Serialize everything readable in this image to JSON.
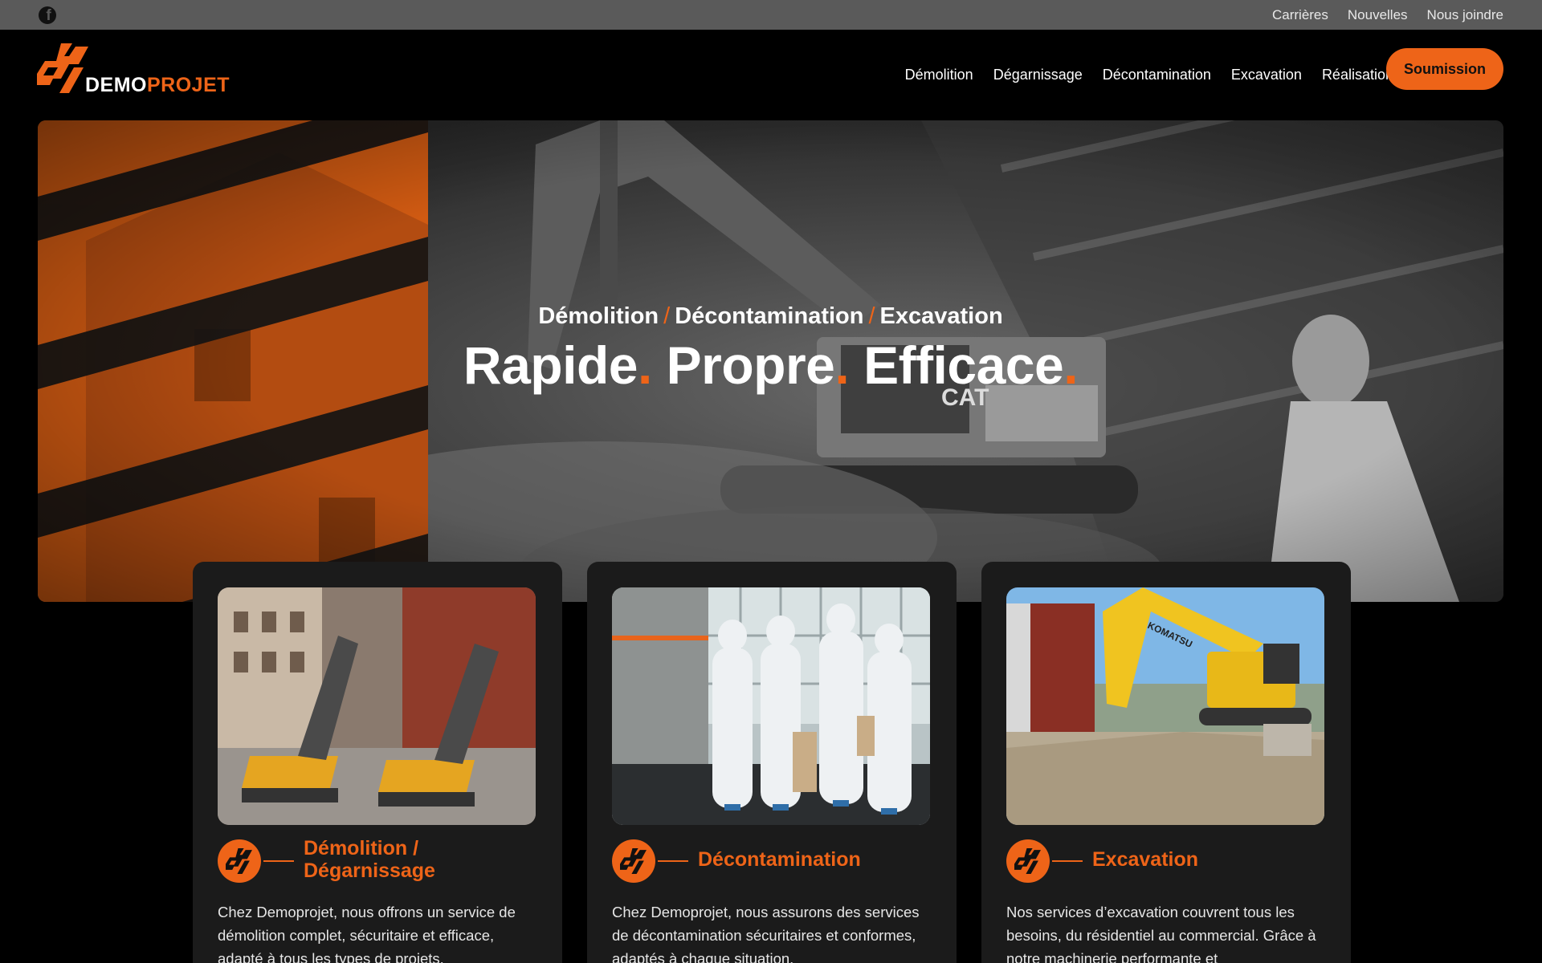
{
  "topbar": {
    "social_icon": "facebook-icon",
    "links": [
      "Carrières",
      "Nouvelles",
      "Nous joindre"
    ]
  },
  "header": {
    "logo_white": "DEMO",
    "logo_orange": "PROJET",
    "nav": [
      "Démolition",
      "Dégarnissage",
      "Décontamination",
      "Excavation",
      "Réalisations"
    ],
    "cta_label": "Soumission"
  },
  "hero": {
    "subtitle_parts": [
      "Démolition",
      "Décontamination",
      "Excavation"
    ],
    "separator": "/",
    "title_words": [
      "Rapide",
      "Propre",
      "Efficace"
    ],
    "dot": "."
  },
  "services": [
    {
      "title_line1": "Démolition /",
      "title_line2": "Dégarnissage",
      "text": "Chez Demoprojet, nous offrons un service de démolition complet, sécuritaire et efficace, adapté à tous les types de projets."
    },
    {
      "title_line1": "Décontamination",
      "title_line2": "",
      "text": "Chez Demoprojet, nous assurons des services de décontamination sécuritaires et conformes, adaptés à chaque situation."
    },
    {
      "title_line1": "Excavation",
      "title_line2": "",
      "text": "Nos services d’excavation couvrent tous les besoins, du résidentiel au commercial. Grâce à notre machinerie performante et"
    }
  ],
  "colors": {
    "accent": "#ee6418",
    "background": "#000000",
    "card": "#1b1b1b",
    "topbar": "#5a5a5a"
  }
}
